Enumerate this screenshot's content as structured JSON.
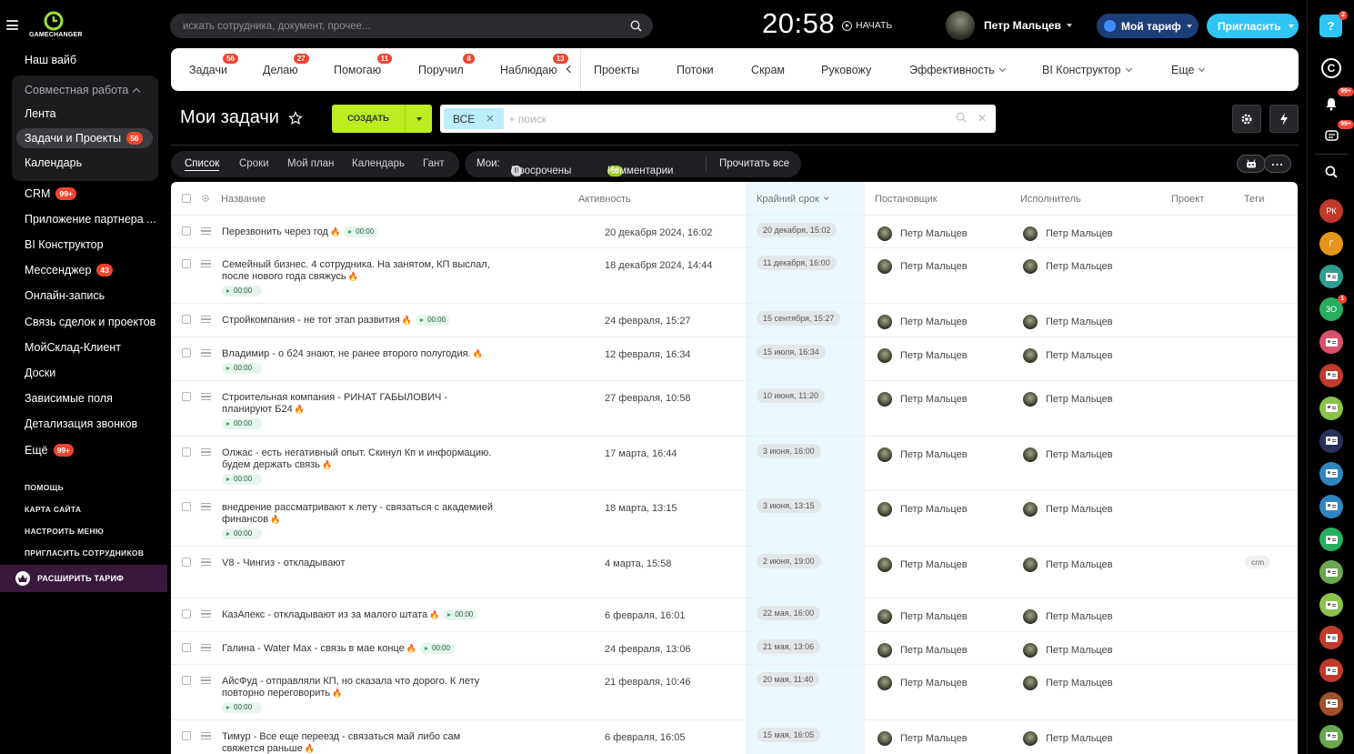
{
  "app": {
    "logo_text": "GAMECHANGER"
  },
  "topbar": {
    "search_placeholder": "искать сотрудника, документ, прочее...",
    "clock": "20:58",
    "start_label": "НАЧАТЬ",
    "user_name": "Петр Мальцев",
    "tariff_label": "Мой тариф",
    "invite_label": "Пригласить"
  },
  "sidebar": {
    "items": [
      {
        "label": "Наш вайб"
      },
      {
        "label": "Совместная работа",
        "group_header": true
      },
      {
        "label": "Лента"
      },
      {
        "label": "Задачи и Проекты",
        "badge": "56",
        "active": true
      },
      {
        "label": "Календарь"
      },
      {
        "label": "CRM",
        "badge": "99+"
      },
      {
        "label": "Приложение партнера ..."
      },
      {
        "label": "BI Конструктор"
      },
      {
        "label": "Мессенджер",
        "badge": "43"
      },
      {
        "label": "Онлайн-запись"
      },
      {
        "label": "Связь сделок и проектов"
      },
      {
        "label": "МойСклад-Клиент"
      },
      {
        "label": "Доски"
      },
      {
        "label": "Зависимые поля"
      },
      {
        "label": "Детализация звонков"
      },
      {
        "label": "Ещё",
        "badge": "99+"
      }
    ],
    "footer": [
      "ПОМОЩЬ",
      "КАРТА САЙТА",
      "НАСТРОИТЬ МЕНЮ",
      "ПРИГЛАСИТЬ СОТРУДНИКОВ"
    ],
    "upgrade_label": "РАСШИРИТЬ ТАРИФ"
  },
  "nav": {
    "left_tabs": [
      {
        "label": "Задачи",
        "badge": "56"
      },
      {
        "label": "Делаю",
        "badge": "27"
      },
      {
        "label": "Помогаю",
        "badge": "11"
      },
      {
        "label": "Поручил",
        "badge": "8"
      },
      {
        "label": "Наблюдаю",
        "badge": "13"
      }
    ],
    "right_tabs": [
      {
        "label": "Проекты"
      },
      {
        "label": "Потоки"
      },
      {
        "label": "Скрам"
      },
      {
        "label": "Руковожу"
      },
      {
        "label": "Эффективность",
        "dropdown": true
      },
      {
        "label": "BI Конструктор",
        "dropdown": true
      },
      {
        "label": "Еще",
        "dropdown": true
      }
    ]
  },
  "toolbar": {
    "title": "Мои задачи",
    "create_label": "СОЗДАТЬ",
    "filter_chip": "ВСЕ",
    "filter_placeholder": "+ поиск"
  },
  "views": [
    "Список",
    "Сроки",
    "Мой план",
    "Календарь",
    "Гант"
  ],
  "counters": {
    "mine_label": "Мои:",
    "overdue_count": "0",
    "overdue_label": "Просрочены",
    "comments_count": "56",
    "comments_label": "Комментарии",
    "read_all_label": "Прочитать все"
  },
  "table": {
    "columns": [
      "Название",
      "Активность",
      "Крайний срок",
      "Постановщик",
      "Исполнитель",
      "Проект",
      "Теги"
    ],
    "rows": [
      {
        "title": "Перезвонить через год",
        "fire": true,
        "timer": "00:00",
        "timer_inline": true,
        "activity": "20 декабря 2024, 16:02",
        "deadline": "20 декабря, 15:02",
        "creator": "Петр Мальцев",
        "assignee": "Петр Мальцев",
        "tag": ""
      },
      {
        "title": "Семейный бизнес. 4 сотрудника. На занятом, КП выслал, после нового года свяжусь",
        "fire": true,
        "timer": "00:00",
        "timer_inline": false,
        "activity": "18 декабря 2024, 14:44",
        "deadline": "11 декабря, 16:00",
        "creator": "Петр Мальцев",
        "assignee": "Петр Мальцев",
        "tag": ""
      },
      {
        "title": "Стройкомпания - не тот этап развития",
        "fire": true,
        "timer": "00:00",
        "timer_inline": true,
        "activity": "24 февраля, 15:27",
        "deadline": "15 сентября, 15:27",
        "creator": "Петр Мальцев",
        "assignee": "Петр Мальцев",
        "tag": ""
      },
      {
        "title": "Владимир - о б24 знают, не ранее второго полугодия.",
        "fire": true,
        "timer": "00:00",
        "timer_inline": false,
        "activity": "12 февраля, 16:34",
        "deadline": "15 июля, 16:34",
        "creator": "Петр Мальцев",
        "assignee": "Петр Мальцев",
        "tag": ""
      },
      {
        "title": "Строительная компания - РИНАТ ГАБЫЛОВИЧ - планируют Б24",
        "fire": true,
        "timer": "00:00",
        "timer_inline": false,
        "activity": "27 февраля, 10:58",
        "deadline": "10 июня, 11:20",
        "creator": "Петр Мальцев",
        "assignee": "Петр Мальцев",
        "tag": ""
      },
      {
        "title": "Олжас - есть негативный опыт. Скинул Кп и информацию. будем держать связь",
        "fire": true,
        "timer": "00:00",
        "timer_inline": false,
        "activity": "17 марта, 16:44",
        "deadline": "3 июня, 16:00",
        "creator": "Петр Мальцев",
        "assignee": "Петр Мальцев",
        "tag": ""
      },
      {
        "title": "внедрение рассматривают к лету - связаться с академией финансов",
        "fire": true,
        "timer": "00:00",
        "timer_inline": false,
        "activity": "18 марта, 13:15",
        "deadline": "3 июня, 13:15",
        "creator": "Петр Мальцев",
        "assignee": "Петр Мальцев",
        "tag": ""
      },
      {
        "title": "V8 - Чингиз - откладывают",
        "fire": false,
        "timer": "",
        "timer_inline": false,
        "activity": "4 марта, 15:58",
        "deadline": "2 июня, 19:00",
        "creator": "Петр Мальцев",
        "assignee": "Петр Мальцев",
        "tag": "crm"
      },
      {
        "title": "КазАпекс - откладывают из за малого штата",
        "fire": true,
        "timer": "00:00",
        "timer_inline": true,
        "activity": "6 февраля, 16:01",
        "deadline": "22 мая, 16:00",
        "creator": "Петр Мальцев",
        "assignee": "Петр Мальцев",
        "tag": ""
      },
      {
        "title": "Галина - Water Max - связь в мае конце",
        "fire": true,
        "timer": "00:00",
        "timer_inline": true,
        "activity": "24 февраля, 13:06",
        "deadline": "21 мая, 13:06",
        "creator": "Петр Мальцев",
        "assignee": "Петр Мальцев",
        "tag": ""
      },
      {
        "title": "АйсФуд - отправляли КП, но сказала что дорого. К лету повторно переговорить",
        "fire": true,
        "timer": "00:00",
        "timer_inline": false,
        "activity": "21 февраля, 10:46",
        "deadline": "20 мая, 11:40",
        "creator": "Петр Мальцев",
        "assignee": "Петр Мальцев",
        "tag": ""
      },
      {
        "title": "Тимур - Все еще переезд - связаться май либо сам свяжется раньше",
        "fire": true,
        "timer": "",
        "timer_inline": false,
        "activity": "6 февраля, 16:05",
        "deadline": "15 мая, 16:05",
        "creator": "Петр Мальцев",
        "assignee": "Петр Мальцев",
        "tag": ""
      }
    ]
  },
  "right_rail": {
    "help_badge": "2",
    "bell_badge": "99+",
    "chat_badge": "99+",
    "contacts": [
      {
        "initials": "РК",
        "color": "#c0392b"
      },
      {
        "initials": "Г",
        "color": "#e6951b"
      },
      {
        "initials": "",
        "color": "#2e9e8f"
      },
      {
        "initials": "ЗО",
        "color": "#27ae60",
        "badge": "1"
      },
      {
        "initials": "",
        "color": "#d9506b"
      },
      {
        "initials": "",
        "color": "#c0392b"
      },
      {
        "initials": "",
        "color": "#8bc34a"
      },
      {
        "initials": "",
        "color": "#2a2f5a"
      },
      {
        "initials": "",
        "color": "#2e86c1"
      },
      {
        "initials": "",
        "color": "#2e86c1"
      },
      {
        "initials": "",
        "color": "#27ae60"
      },
      {
        "initials": "",
        "color": "#6aa84f"
      },
      {
        "initials": "",
        "color": "#8bc34a"
      },
      {
        "initials": "",
        "color": "#c0392b"
      },
      {
        "initials": "",
        "color": "#c0392b"
      },
      {
        "initials": "",
        "color": "#a0522d"
      },
      {
        "initials": "",
        "color": "#6aa84f"
      }
    ]
  }
}
